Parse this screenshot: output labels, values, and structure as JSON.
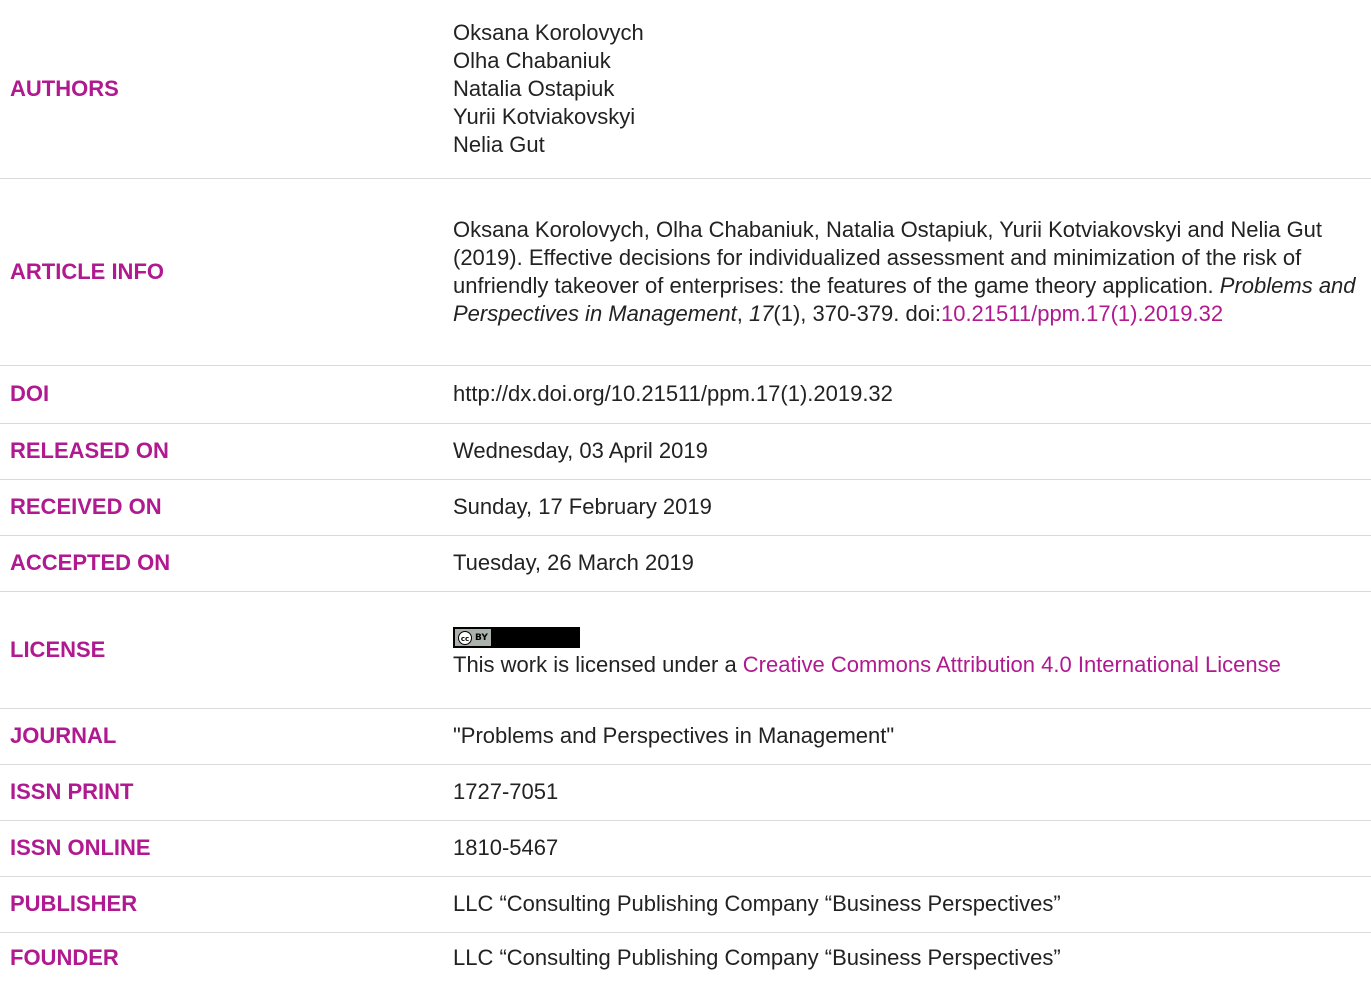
{
  "authors": {
    "label": "AUTHORS",
    "names": [
      "Oksana Korolovych",
      "Olha Chabaniuk",
      "Natalia Ostapiuk",
      "Yurii Kotviakovskyi",
      "Nelia Gut"
    ]
  },
  "article_info": {
    "label": "ARTICLE INFO",
    "citation_prefix": "Oksana Korolovych, Olha Chabaniuk, Natalia Ostapiuk, Yurii Kotviakovskyi and Nelia Gut (2019). Effective decisions for individualized assessment and minimization of the risk of unfriendly takeover of enterprises: the features of the game theory application. ",
    "journal_italic": "Problems and Perspectives in Management",
    "comma1": ", ",
    "volume_italic": "17",
    "issue_pages": "(1), 370-379. doi:",
    "doi_link": "10.21511/ppm.17(1).2019.32"
  },
  "doi": {
    "label": "DOI",
    "value": "http://dx.doi.org/10.21511/ppm.17(1).2019.32"
  },
  "released": {
    "label": "RELEASED ON",
    "value": "Wednesday, 03 April 2019"
  },
  "received": {
    "label": "RECEIVED ON",
    "value": "Sunday, 17 February 2019"
  },
  "accepted": {
    "label": "ACCEPTED ON",
    "value": "Tuesday, 26 March 2019"
  },
  "license": {
    "label": "LICENSE",
    "badge_cc": "cc",
    "badge_by": "BY",
    "text_prefix": "This work is licensed under a ",
    "link_text": "Creative Commons Attribution 4.0 International License"
  },
  "journal": {
    "label": "JOURNAL",
    "value": "\"Problems and Perspectives in Management\""
  },
  "issn_print": {
    "label": "ISSN PRINT",
    "value": "1727-7051"
  },
  "issn_online": {
    "label": "ISSN ONLINE",
    "value": "1810-5467"
  },
  "publisher": {
    "label": "PUBLISHER",
    "value": "LLC “Consulting Publishing Company “Business Perspectives”"
  },
  "founder": {
    "label": "FOUNDER",
    "value": "LLC “Consulting Publishing Company “Business Perspectives”"
  },
  "colors": {
    "label": "#b0198f",
    "link": "#b0198f",
    "divider": "#d9d9d9"
  }
}
